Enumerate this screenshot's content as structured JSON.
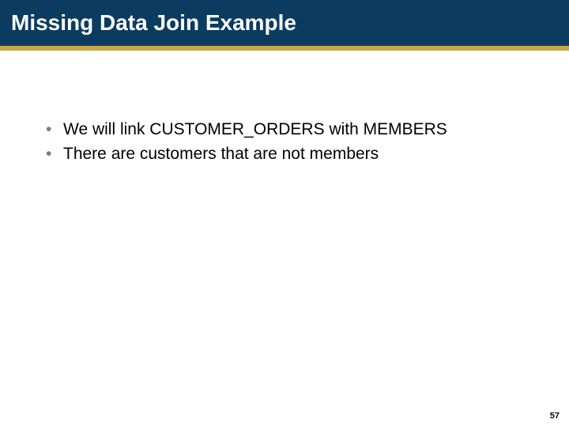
{
  "title": "Missing Data Join Example",
  "bullets": [
    "We will link CUSTOMER_ORDERS with MEMBERS",
    "There are customers that are not members"
  ],
  "page_number": "57"
}
